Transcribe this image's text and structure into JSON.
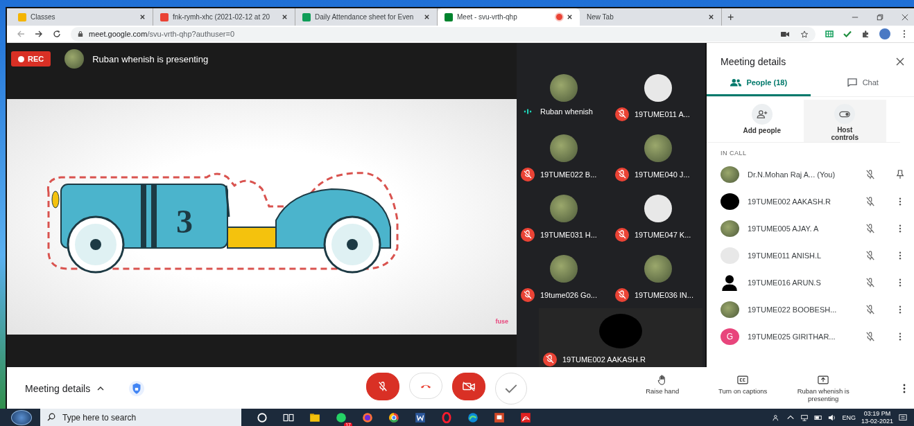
{
  "browser": {
    "tabs": [
      {
        "title": "Classes",
        "selected": false,
        "recording": false
      },
      {
        "title": "fnk-rymh-xhc (2021-02-12 at 20",
        "selected": false,
        "recording": false
      },
      {
        "title": "Daily Attendance sheet for Even",
        "selected": false,
        "recording": false
      },
      {
        "title": "Meet - svu-vrth-qhp",
        "selected": true,
        "recording": true
      },
      {
        "title": "New Tab",
        "selected": false,
        "recording": false
      }
    ],
    "new_tab": "+",
    "url_host": "meet.google.com",
    "url_path": "/svu-vrth-qhp?authuser=0"
  },
  "meet": {
    "rec": "REC",
    "presenting_banner": "Ruban whenish is presenting",
    "slide": {
      "number": "3",
      "logo": "fuse"
    },
    "tiles": [
      {
        "name": "Ruban whenish",
        "muted": false
      },
      {
        "name": "19TUME011 A...",
        "muted": true
      },
      {
        "name": "19TUME022 B...",
        "muted": true
      },
      {
        "name": "19TUME040 J...",
        "muted": true
      },
      {
        "name": "19TUME031 H...",
        "muted": true
      },
      {
        "name": "19TUME047 K...",
        "muted": true
      },
      {
        "name": "19tume026 Go...",
        "muted": true
      },
      {
        "name": "19TUME036 IN...",
        "muted": true
      }
    ],
    "featured_tile": {
      "name": "19TUME002 AAKASH.R",
      "muted": true
    }
  },
  "panel": {
    "title": "Meeting details",
    "tabs": [
      {
        "label": "People (18)",
        "kind": "people",
        "selected": true
      },
      {
        "label": "Chat",
        "kind": "chat",
        "selected": false
      }
    ],
    "actions": [
      {
        "label": "Add people",
        "kind": "add"
      },
      {
        "label": "Host controls",
        "kind": "host"
      }
    ],
    "section": "IN CALL",
    "people": [
      {
        "name": "Dr.N.Mohan Raj A... (You)",
        "self": true
      },
      {
        "name": "19TUME002 AAKASH.R",
        "self": false
      },
      {
        "name": "19TUME005 AJAY. A",
        "self": false
      },
      {
        "name": "19TUME011 ANISH.L",
        "self": false
      },
      {
        "name": "19TUME016 ARUN.S",
        "self": false
      },
      {
        "name": "19TUME022 BOOBESH...",
        "self": false
      },
      {
        "name": "19TUME025 GIRITHAR...",
        "letter": "G",
        "color": "#e8457c",
        "self": false
      }
    ]
  },
  "bottom_bar": {
    "details_label": "Meeting details",
    "controls": [
      {
        "kind": "mic",
        "on": false
      },
      {
        "kind": "hangup",
        "on": true
      },
      {
        "kind": "camera",
        "on": false
      },
      {
        "kind": "present",
        "on": true
      }
    ],
    "actions": [
      {
        "label": "Raise hand",
        "kind": "hand"
      },
      {
        "label": "Turn on captions",
        "kind": "captions"
      },
      {
        "label": "Ruban whenish is presenting",
        "kind": "present"
      }
    ]
  },
  "taskbar": {
    "search_placeholder": "Type here to search",
    "chat_badge": "17",
    "language": "ENG",
    "time": "03:19 PM",
    "date": "13-02-2021"
  }
}
